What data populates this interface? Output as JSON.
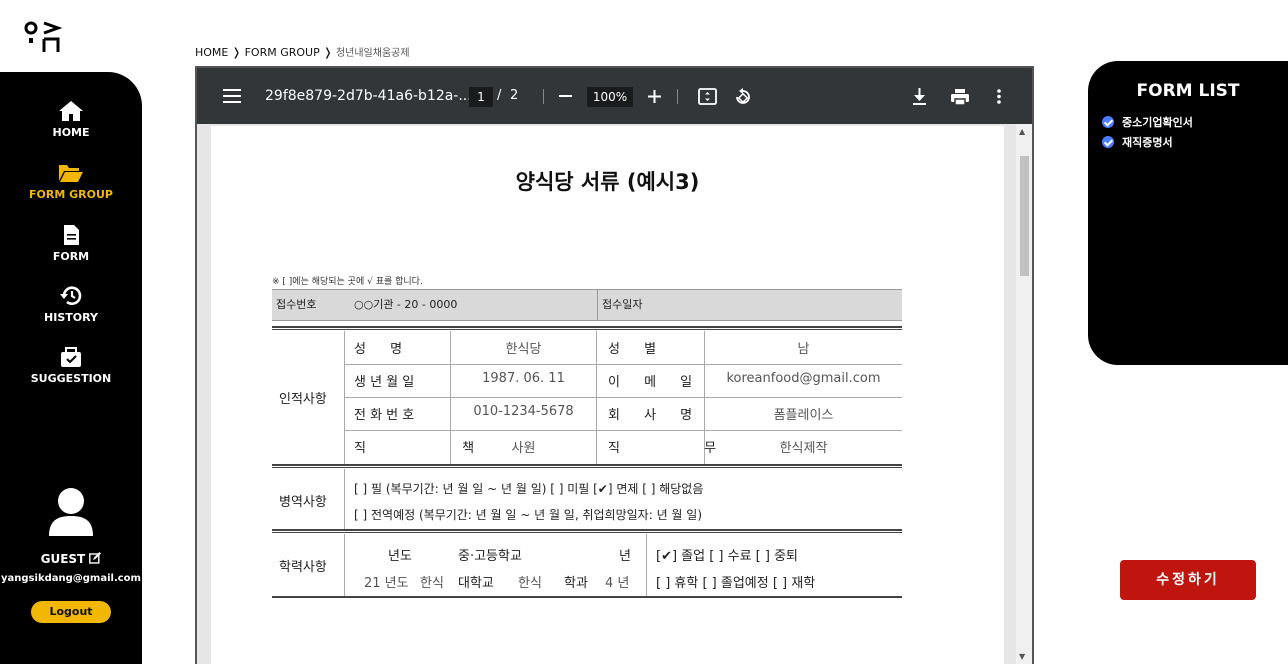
{
  "sidebar": {
    "items": [
      {
        "label": "HOME",
        "icon": "home-icon"
      },
      {
        "label": "FORM GROUP",
        "icon": "folder-open-icon",
        "active": true
      },
      {
        "label": "FORM",
        "icon": "document-icon"
      },
      {
        "label": "HISTORY",
        "icon": "history-icon"
      },
      {
        "label": "SUGGESTION",
        "icon": "suggestion-icon"
      }
    ],
    "active_color": "#f2b705",
    "user": {
      "name": "GUEST",
      "email": "yangsikdang@gmail.com"
    },
    "logout_label": "Logout"
  },
  "breadcrumb": {
    "home": "HOME",
    "group": "FORM GROUP",
    "current": "청년내일채움공제"
  },
  "viewer": {
    "filename": "29f8e879-2d7b-41a6-b12a-...",
    "page_current": "1",
    "page_sep": "/",
    "page_total": "2",
    "zoom": "100%"
  },
  "document": {
    "title": "양식당  서류 (예시3)",
    "note": "※ [   ]에는 해당되는 곳에 √ 표를 합니다.",
    "reg_no_label": "접수번호",
    "reg_no_value": "○○기관 - 20    - 0000",
    "reg_date_label": "접수일자",
    "personal": {
      "section": "인적사항",
      "name_label": "성 명",
      "name_value": "한식당",
      "gender_label": "성 별",
      "gender_value": "남",
      "birth_label": "생 년 월 일",
      "birth_value": "1987. 06. 11",
      "email_label": "이 메 일",
      "email_value": "koreanfood@gmail.com",
      "phone_label": "전 화 번 호",
      "phone_value": "010-1234-5678",
      "company_label": "회 사 명",
      "company_value": "폼플레이스",
      "position_label": "직 책",
      "position_value": "사원",
      "duty_label": "직 무",
      "duty_value": "한식제작"
    },
    "military": {
      "section": "병역사항",
      "line1": "[  ] 필 (복무기간:  년  월  일 ~  년  월  일)  [  ] 미필  [✔] 면제  [  ] 해당없음",
      "line2": "[  ] 전역예정 (복무기간:  년  월  일 ~  년  월  일, 취업희망일자:  년  월  일)"
    },
    "education": {
      "section": "학력사항",
      "r1_year": "년도",
      "r1_school": "중·고등학교",
      "r1_nyeon": "년",
      "r1_status": "[✔] 졸업  [  ] 수료    [  ] 중퇴",
      "r2_year": "21  년도",
      "r2_val1": "한식",
      "r2_school": "대학교",
      "r2_val2": "한식",
      "r2_major": "학과",
      "r2_grade": "4 년",
      "r2_status": "[  ] 휴학  [  ] 졸업예정  [  ] 재학"
    }
  },
  "form_list": {
    "title": "FORM LIST",
    "items": [
      "중소기업확인서",
      "재직증명서"
    ]
  },
  "edit_button": "수정하기",
  "colors": {
    "sidebar_bg": "#000000",
    "accent": "#f2b705",
    "edit_button": "#c0150f",
    "check": "#4a7dff"
  }
}
